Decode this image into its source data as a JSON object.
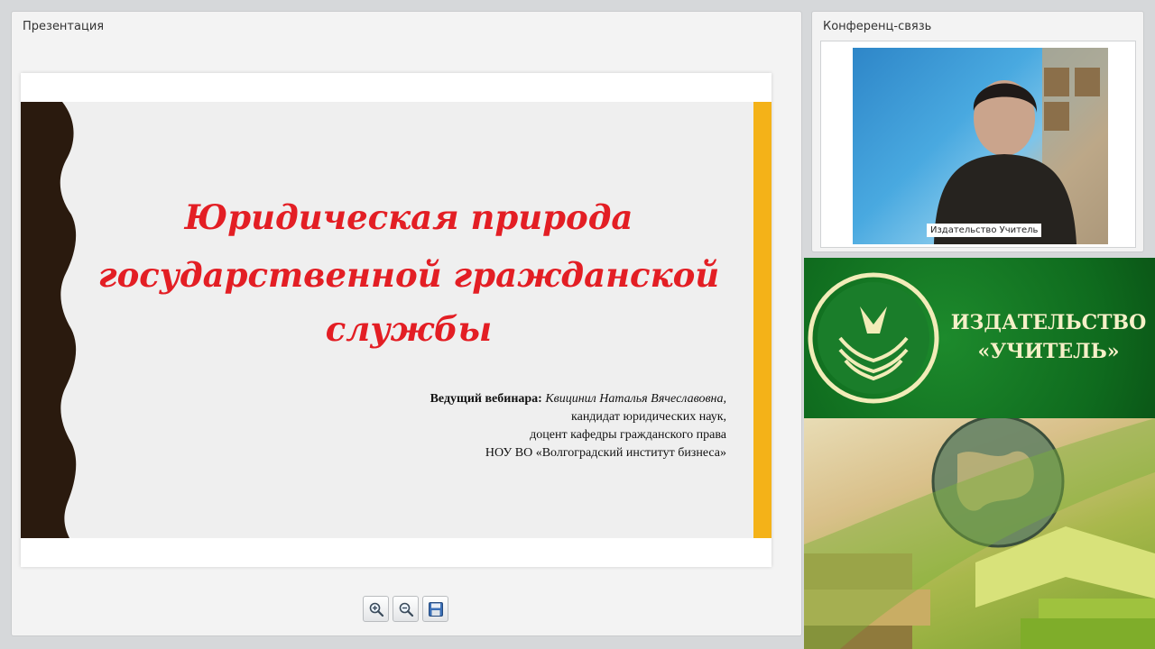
{
  "presentation_panel": {
    "title": "Презентация",
    "slide": {
      "title_line1": "Юридическая природа",
      "title_line2": "государственной гражданской службы",
      "presenter_label": "Ведущий вебинара:",
      "presenter_name": "Квицинил Наталья Вячеславовна,",
      "presenter_line2": "кандидат юридических наук,",
      "presenter_line3": "доцент кафедры гражданского права",
      "presenter_line4": "НОУ ВО «Волгоградский институт бизнеса»"
    },
    "toolbar": {
      "zoom_in_icon": "zoom-in-icon",
      "zoom_out_icon": "zoom-out-icon",
      "save_icon": "save-icon"
    }
  },
  "conference_panel": {
    "title": "Конференц-связь",
    "participant_name": "Издательство Учитель"
  },
  "banner": {
    "line1": "ИЗДАТЕЛЬСТВО",
    "line2": "«УЧИТЕЛЬ»"
  },
  "colors": {
    "slide_title": "#e31e24",
    "slide_accent": "#f4b218",
    "banner_green": "#0f6b1e",
    "banner_text": "#f6f0c8"
  }
}
